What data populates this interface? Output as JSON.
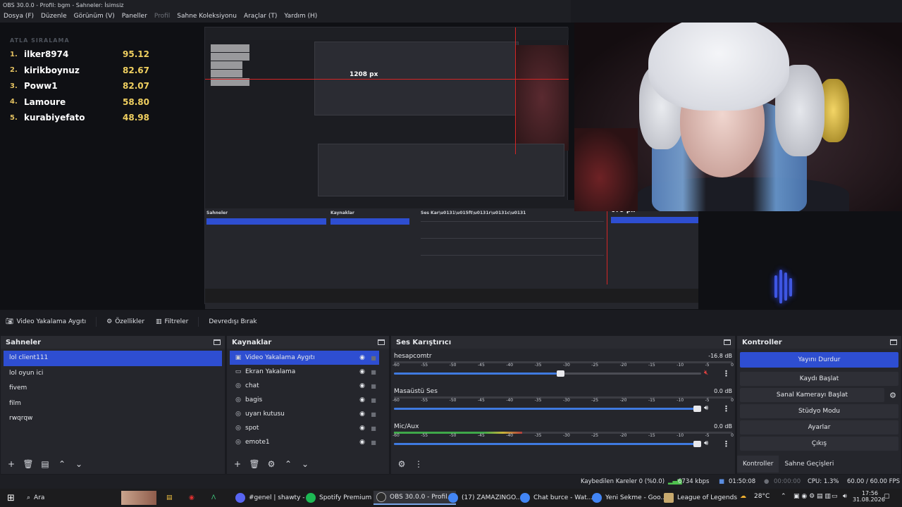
{
  "window": {
    "title": "OBS 30.0.0 - Profil: bgm - Sahneler: İsimsiz"
  },
  "menu": [
    "Dosya (F)",
    "Düzenle",
    "Görünüm (V)",
    "Paneller",
    "Profil",
    "Sahne Koleksiyonu",
    "Araçlar (T)",
    "Yardım (H)"
  ],
  "preview": {
    "leaderboard": {
      "title": "ATLA SIRALAMA",
      "rows": [
        {
          "rank": "1.",
          "name": "ilker8974",
          "score": "95.12"
        },
        {
          "rank": "2.",
          "name": "kirikboynuz",
          "score": "82.67"
        },
        {
          "rank": "3.",
          "name": "Poww1",
          "score": "82.07"
        },
        {
          "rank": "4.",
          "name": "Lamoure",
          "score": "58.80"
        },
        {
          "rank": "5.",
          "name": "kurabiyefato",
          "score": "48.98"
        }
      ]
    },
    "measure_1": "1208 px",
    "measure_2": "679 px"
  },
  "source_toolbar": {
    "source_name": "Video Yakalama Aygıtı",
    "properties": "Özellikler",
    "filters": "Filtreler",
    "deactivate": "Devredışı Bırak"
  },
  "scenes": {
    "title": "Sahneler",
    "items": [
      "lol client111",
      "lol oyun ici",
      "fivem",
      "film",
      "rwqrqw"
    ]
  },
  "sources": {
    "title": "Kaynaklar",
    "items": [
      {
        "label": "Video Yakalama Aygıtı",
        "icon": "camera-icon"
      },
      {
        "label": "Ekran Yakalama",
        "icon": "monitor-icon"
      },
      {
        "label": "chat",
        "icon": "globe-icon"
      },
      {
        "label": "bagis",
        "icon": "globe-icon"
      },
      {
        "label": "uyarı kutusu",
        "icon": "globe-icon"
      },
      {
        "label": "spot",
        "icon": "globe-icon"
      },
      {
        "label": "emote1",
        "icon": "globe-icon"
      }
    ]
  },
  "mixer": {
    "title": "Ses Karıştırıcı",
    "ticks": [
      "-60",
      "-55",
      "-50",
      "-45",
      "-40",
      "-35",
      "-30",
      "-25",
      "-20",
      "-15",
      "-10",
      "-5",
      "0"
    ],
    "tracks": [
      {
        "name": "hesapcomtr",
        "db": "-16.8 dB",
        "level": 0.0,
        "volume": 0.53,
        "muted": true
      },
      {
        "name": "Masaüstü Ses",
        "db": "0.0 dB",
        "level": 0.0,
        "volume": 1.0,
        "muted": false
      },
      {
        "name": "Mic/Aux",
        "db": "0.0 dB",
        "level": 0.38,
        "volume": 1.0,
        "muted": false
      }
    ]
  },
  "controls": {
    "title": "Kontroller",
    "stop_stream": "Yayını Durdur",
    "start_recording": "Kaydı Başlat",
    "start_virtual_cam": "Sanal Kamerayı Başlat",
    "studio_mode": "Stüdyo Modu",
    "settings": "Ayarlar",
    "exit": "Çıkış",
    "tab_controls": "Kontroller",
    "tab_transitions": "Sahne Geçişleri"
  },
  "status": {
    "dropped": "Kaybedilen Kareler 0 (%0.0)",
    "bitrate": "6734 kbps",
    "stream_time": "01:50:08",
    "rec_time": "00:00:00",
    "cpu": "CPU: 1.3%",
    "fps": "60.00 / 60.00 FPS"
  },
  "taskbar": {
    "search": "Ara",
    "apps": [
      {
        "label": "#genel | shawty - ...",
        "color": "#5865f2"
      },
      {
        "label": "Spotify Premium",
        "color": "#1db954"
      },
      {
        "label": "OBS 30.0.0 - Profil...",
        "color": "#2b2b2b"
      },
      {
        "label": "(17) ZAMAZINGO...",
        "color": "#4285f4"
      },
      {
        "label": "Chat burce - Wat...",
        "color": "#4285f4"
      },
      {
        "label": "Yeni Sekme - Goo...",
        "color": "#4285f4"
      },
      {
        "label": "League of Legends",
        "color": "#c8aa6e"
      }
    ],
    "temp": "28°C",
    "time": "17:56",
    "date": "31.08.2026"
  }
}
